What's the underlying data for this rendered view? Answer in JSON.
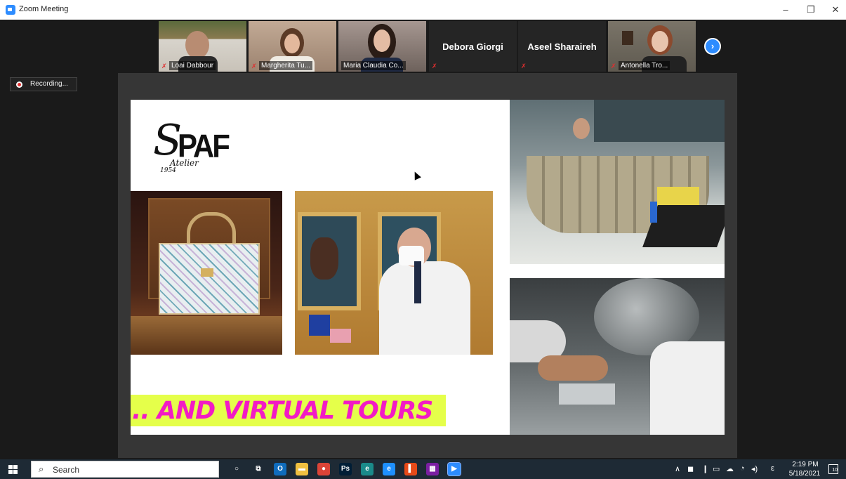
{
  "window": {
    "title": "Zoom Meeting",
    "controls": {
      "minimize": "–",
      "restore": "❐",
      "close": "✕"
    }
  },
  "participants": [
    {
      "name": "Loai Dabbour",
      "video": true,
      "muted": true,
      "bg": "#6e6453"
    },
    {
      "name": "Margherita Tu...",
      "video": true,
      "muted": true,
      "bg": "#b59a85"
    },
    {
      "name": "Maria Claudia Co...",
      "video": true,
      "muted": false,
      "active": true,
      "bg": "#8c7d78"
    },
    {
      "name": "Debora Giorgi",
      "video": false,
      "muted": true
    },
    {
      "name": "Aseel Sharaireh",
      "video": false,
      "muted": true
    },
    {
      "name": "Antonella Tro...",
      "video": true,
      "muted": true,
      "bg": "#6f6a60"
    }
  ],
  "recording": {
    "label": "Recording..."
  },
  "slide": {
    "logo": {
      "mark": "S",
      "letters": "PAF",
      "script": "Atelier",
      "year": "1954"
    },
    "tagline": ".. AND VIRTUAL TOURS",
    "colors": {
      "tagline_bg": "#e5ff4a",
      "tagline_text": "#f21bc5"
    }
  },
  "taskbar": {
    "search_placeholder": "Search",
    "apps": [
      {
        "icon": "cortana-icon",
        "glyph": "○",
        "color": "transparent"
      },
      {
        "icon": "task-view-icon",
        "glyph": "⧉",
        "color": "transparent"
      },
      {
        "icon": "outlook-icon",
        "glyph": "O",
        "color": "#0f6cbd"
      },
      {
        "icon": "file-explorer-icon",
        "glyph": "▬",
        "color": "#f0c040"
      },
      {
        "icon": "chrome-icon",
        "glyph": "●",
        "color": "#db4437"
      },
      {
        "icon": "photoshop-icon",
        "glyph": "Ps",
        "color": "#001e36"
      },
      {
        "icon": "edge-icon",
        "glyph": "e",
        "color": "#1a8a8a"
      },
      {
        "icon": "ie-icon",
        "glyph": "e",
        "color": "#1e90ff"
      },
      {
        "icon": "office-icon",
        "glyph": "▌",
        "color": "#e64a19"
      },
      {
        "icon": "app-icon",
        "glyph": "▦",
        "color": "#7b1fa2"
      },
      {
        "icon": "zoom-icon",
        "glyph": "▶",
        "color": "#2d8cff"
      }
    ],
    "clock": {
      "time": "2:19 PM",
      "date": "5/18/2021"
    },
    "notifications": "10"
  }
}
